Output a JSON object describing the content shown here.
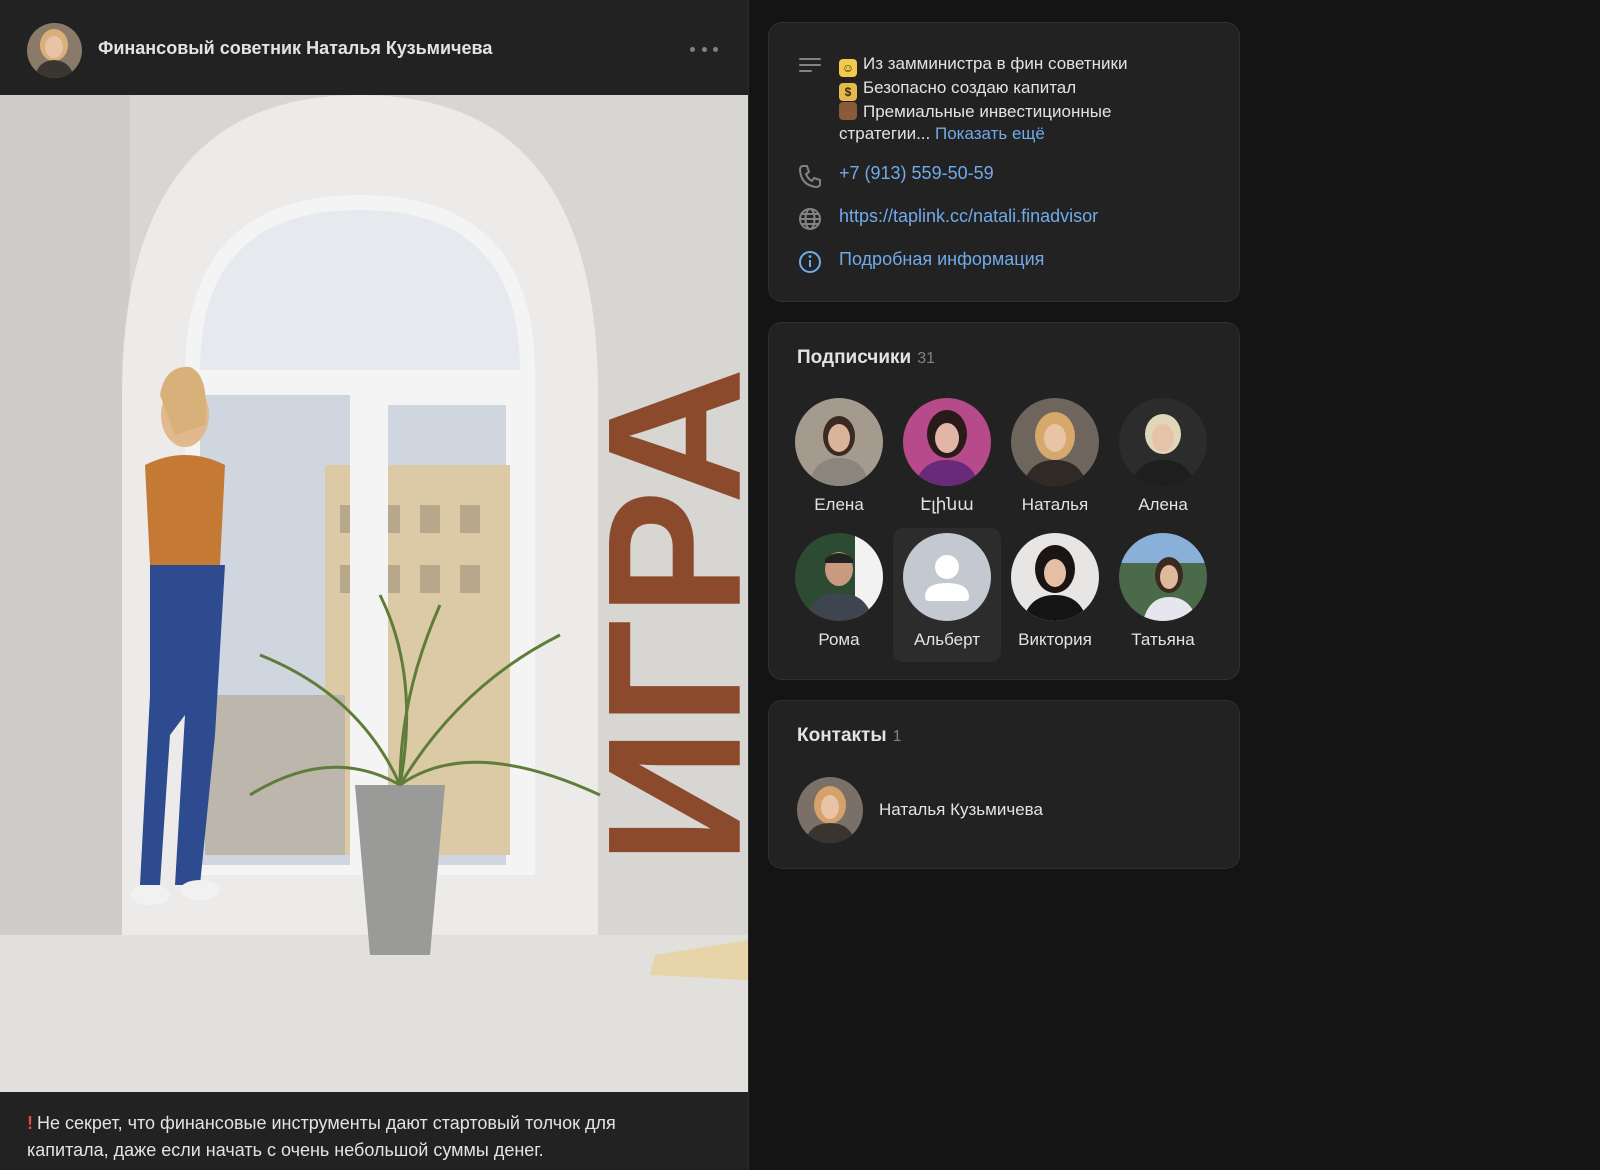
{
  "post": {
    "author": "Финансовый советник Наталья Кузьмичева",
    "photo_text": "ИГРА",
    "text": "Не секрет, что финансовые инструменты дают стартовый толчок для капитала, даже если начать с очень небольшой суммы денег.",
    "text_line1": "Не секрет, что финансовые инструменты дают стартовый толчок для",
    "text_line2": "капитала, даже если начать с очень небольшой суммы денег.",
    "excl_icon": "exclamation-icon"
  },
  "info": {
    "description": {
      "line1": "Из замминистра в фин советники",
      "line2": "Безопасно создаю капитал",
      "line3": "Премиальные инвестиционные",
      "line4": "стратегии...",
      "more": "Показать ещё"
    },
    "phone": "+7 (913) 559-50-59",
    "website": "https://taplink.cc/natali.finadvisor",
    "details": "Подробная информация"
  },
  "followers": {
    "title": "Подписчики",
    "count": "31",
    "items": [
      {
        "name": "Елена"
      },
      {
        "name": "Էլինա"
      },
      {
        "name": "Наталья"
      },
      {
        "name": "Алена"
      },
      {
        "name": "Рома"
      },
      {
        "name": "Альберт"
      },
      {
        "name": "Виктория"
      },
      {
        "name": "Татьяна"
      }
    ]
  },
  "contacts": {
    "title": "Контакты",
    "count": "1",
    "items": [
      {
        "name": "Наталья Кузьмичева"
      }
    ]
  },
  "colors": {
    "background": "#141414",
    "card": "#222222",
    "link": "#71aaeb",
    "text": "#e1e3e6",
    "muted": "#828282",
    "photo_accent": "#8b4a2b"
  }
}
